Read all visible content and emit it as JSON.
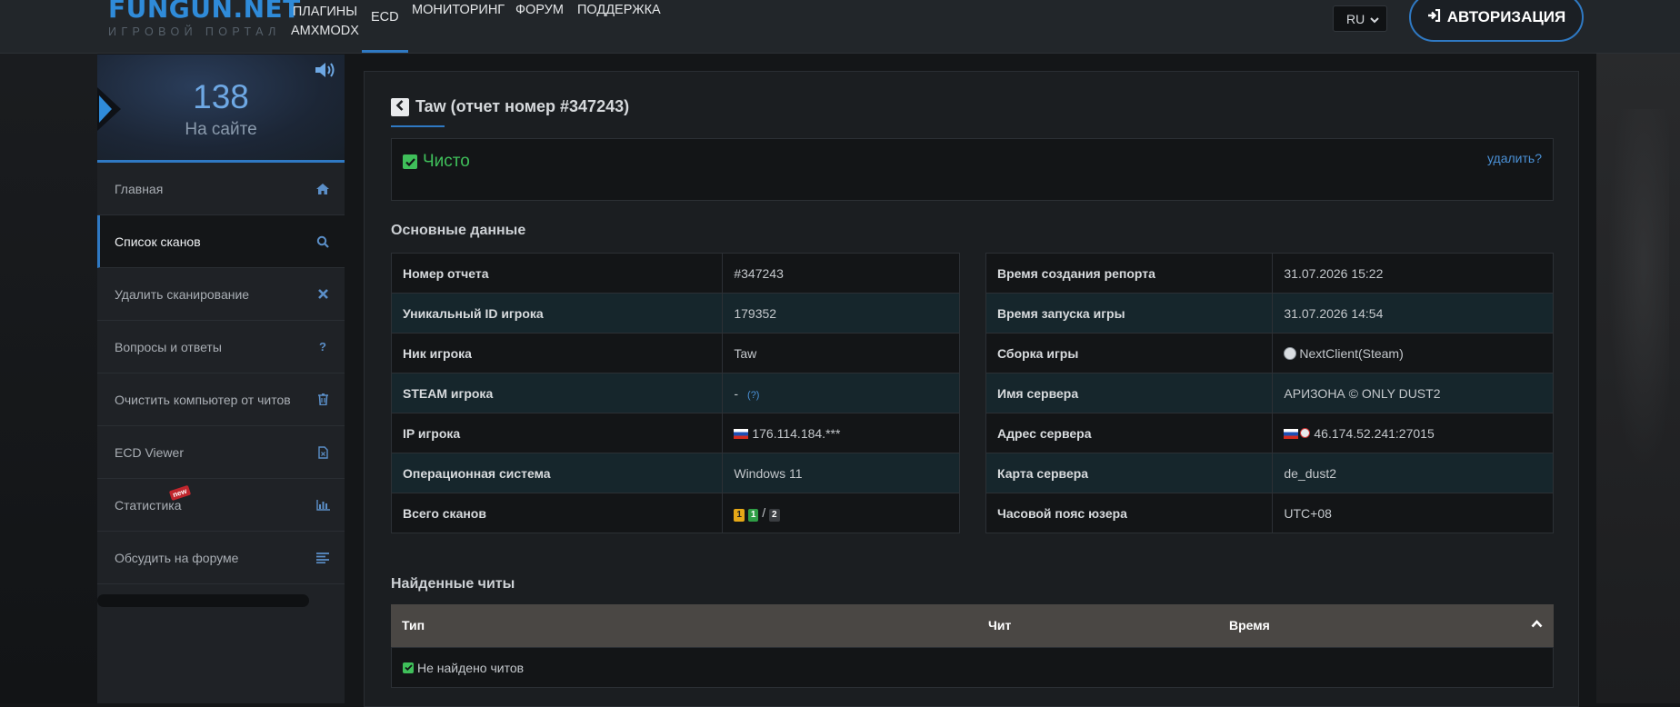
{
  "header": {
    "logo_main": "FUNGUN.NET",
    "logo_sub": "ИГРОВОЙ ПОРТАЛ",
    "nav": [
      {
        "label_line1": "ПЛАГИНЫ",
        "label_line2": "AMXMODX"
      },
      {
        "label": "ECD"
      },
      {
        "label": "МОНИТОРИНГ"
      },
      {
        "label": "ФОРУМ"
      },
      {
        "label": "ПОДДЕРЖКА"
      }
    ],
    "language": "RU",
    "auth_label": "АВТОРИЗАЦИЯ",
    "accent_color": "#2f79c3"
  },
  "sidebar": {
    "online_count": "138",
    "online_label": "На сайте",
    "items": [
      {
        "label": "Главная",
        "icon": "home-icon"
      },
      {
        "label": "Список сканов",
        "icon": "search-icon",
        "active": true
      },
      {
        "label": "Удалить сканирование",
        "icon": "close-icon"
      },
      {
        "label": "Вопросы и ответы",
        "icon": "question-icon"
      },
      {
        "label": "Очистить компьютер от читов",
        "icon": "trash-icon"
      },
      {
        "label": "ECD Viewer",
        "icon": "file-icon"
      },
      {
        "label": "Статистика",
        "icon": "bar-chart-icon",
        "badge": "new"
      },
      {
        "label": "Обсудить на форуме",
        "icon": "list-icon"
      }
    ]
  },
  "report": {
    "title": "Taw (отчет номер #347243)",
    "status": "Чисто",
    "status_color": "#3fbf5a",
    "delete_link": "удалить?",
    "main_section_title": "Основные данные",
    "left_table": [
      {
        "key": "Номер отчета",
        "value": "#347243"
      },
      {
        "key": "Уникальный ID игрока",
        "value": "179352"
      },
      {
        "key": "Ник игрока",
        "value": "Taw"
      },
      {
        "key": "STEAM игрока",
        "value": "-",
        "extra": "(?)"
      },
      {
        "key": "IP игрока",
        "value": "176.114.184.***"
      },
      {
        "key": "Операционная система",
        "value": "Windows 11"
      },
      {
        "key": "Всего сканов",
        "badges": [
          "1",
          "1",
          "2"
        ],
        "separator": "/"
      }
    ],
    "right_table": [
      {
        "key": "Время создания репорта",
        "value": "31.07.2026 15:22"
      },
      {
        "key": "Время запуска игры",
        "value": "31.07.2026 14:54"
      },
      {
        "key": "Сборка игры",
        "value": "NextClient(Steam)"
      },
      {
        "key": "Имя сервера",
        "value": "АРИЗОНА © ONLY DUST2"
      },
      {
        "key": "Адрес сервера",
        "value": "46.174.52.241:27015"
      },
      {
        "key": "Карта сервера",
        "value": "de_dust2"
      },
      {
        "key": "Часовой пояс юзера",
        "value": "UTC+08"
      }
    ],
    "cheats_section_title": "Найденные читы",
    "cheats_columns": [
      "Тип",
      "Чит",
      "Время"
    ],
    "cheats_empty": "Не найдено читов"
  }
}
